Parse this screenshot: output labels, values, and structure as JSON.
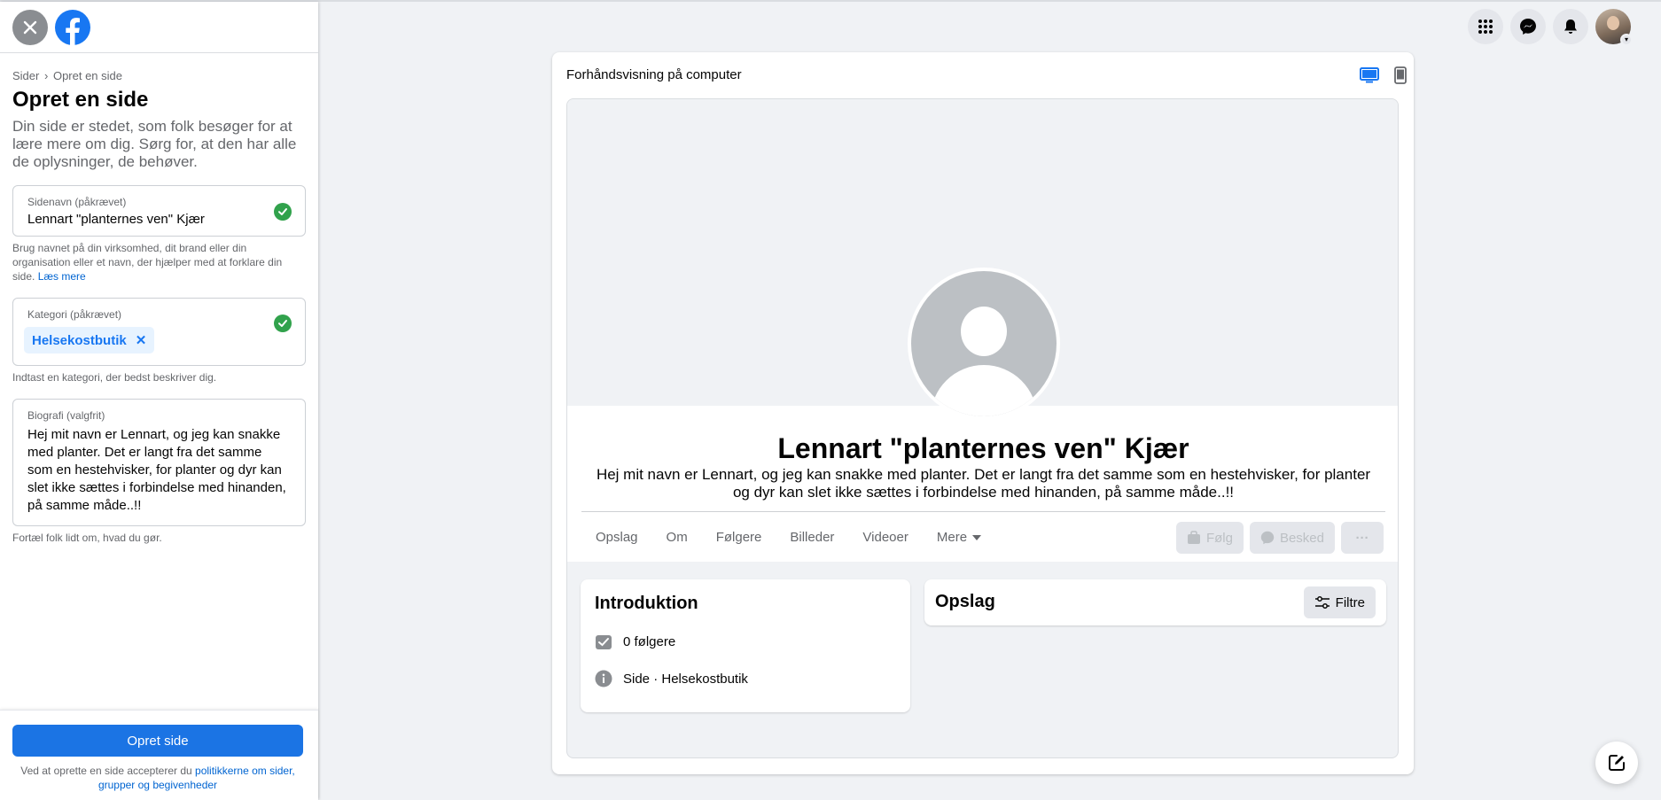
{
  "sidebar": {
    "breadcrumb_root": "Sider",
    "breadcrumb_sep": "›",
    "breadcrumb_current": "Opret en side",
    "title": "Opret en side",
    "description": "Din side er stedet, som folk besøger for at lære mere om dig. Sørg for, at den har alle de oplysninger, de behøver.",
    "name_field": {
      "label": "Sidenavn (påkrævet)",
      "value": "Lennart \"planternes ven\" Kjær",
      "help": "Brug navnet på din virksomhed, dit brand eller din organisation eller et navn, der hjælper med at forklare din side.",
      "help_link": "Læs mere"
    },
    "category_field": {
      "label": "Kategori (påkrævet)",
      "chip": "Helsekostbutik",
      "chip_remove": "✕",
      "help": "Indtast en kategori, der bedst beskriver dig."
    },
    "bio_field": {
      "label": "Biografi (valgfrit)",
      "value": "Hej mit navn er Lennart, og jeg kan snakke med planter. Det er langt fra det samme som en hestehvisker, for planter og dyr kan slet ikke sættes i forbindelse med hinanden, på samme måde..!!",
      "help": "Fortæl folk lidt om, hvad du gør."
    },
    "create_button": "Opret side",
    "terms_prefix": "Ved at oprette en side accepterer du ",
    "terms_link": "politikkerne om sider, grupper og begivenheder"
  },
  "preview": {
    "title": "Forhåndsvisning på computer",
    "page_name": "Lennart \"planternes ven\" Kjær",
    "page_bio": "Hej mit navn er Lennart, og jeg kan snakke med planter. Det er langt fra det samme som en hestehvisker, for planter og dyr kan slet ikke sættes i forbindelse med hinanden, på samme måde..!!",
    "tabs": [
      "Opslag",
      "Om",
      "Følgere",
      "Billeder",
      "Videoer",
      "Mere"
    ],
    "follow_label": "Følg",
    "message_label": "Besked",
    "more_actions": "···",
    "intro_title": "Introduktion",
    "followers": "0 følgere",
    "type_label": "Side",
    "type_sep": " · ",
    "type_value": "Helsekostbutik",
    "posts_title": "Opslag",
    "filter_label": "Filtre"
  },
  "colors": {
    "accent": "#1b74e4",
    "success": "#31a24c",
    "background": "#f0f2f5"
  },
  "icons": [
    "close-icon",
    "facebook-logo-icon",
    "menu-grid-icon",
    "messenger-icon",
    "bell-icon",
    "desktop-icon",
    "mobile-icon",
    "compose-icon"
  ]
}
